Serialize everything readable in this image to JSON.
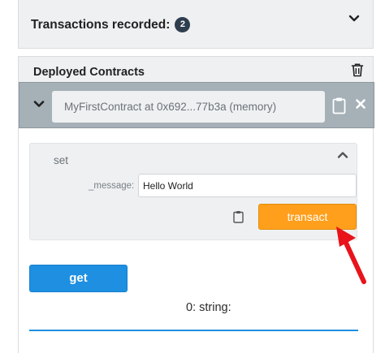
{
  "transactions": {
    "title": "Transactions recorded:",
    "count": "2",
    "chevron_icon": "chevron-down-icon"
  },
  "deployed": {
    "title": "Deployed Contracts",
    "trash_icon": "trash-icon"
  },
  "instance": {
    "name": "MyFirstContract at 0x692...77b3a (memory)",
    "expand_icon": "caret-down-icon",
    "copy_icon": "clipboard-icon",
    "close_icon": "close-icon"
  },
  "set_function": {
    "name": "set",
    "param_label": "_message:",
    "param_value": "Hello World",
    "transact_label": "transact",
    "collapse_icon": "caret-up-icon",
    "copy_icon": "clipboard-icon"
  },
  "get_function": {
    "label": "get",
    "result": "0: string:"
  },
  "annotation": {
    "arrow_icon": "red-arrow-icon"
  },
  "colors": {
    "transact": "#ff9f1c",
    "get": "#1e8fe1",
    "instance_bar": "#a5b0b7",
    "arrow": "#e8131b"
  }
}
